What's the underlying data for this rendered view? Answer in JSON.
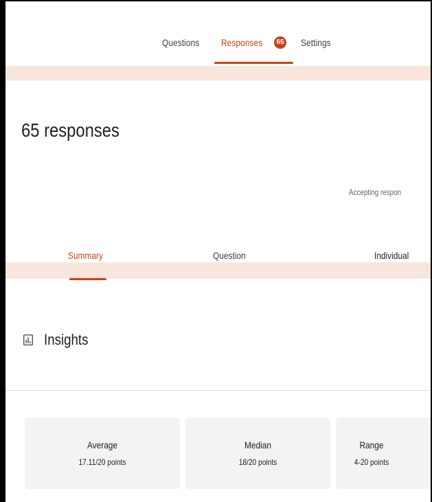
{
  "top_tabs": {
    "questions": "Questions",
    "responses": "Responses",
    "responses_badge": "65",
    "settings": "Settings"
  },
  "header": {
    "title": "65 responses",
    "accepting": "Accepting respon"
  },
  "sub_tabs": {
    "summary": "Summary",
    "question": "Question",
    "individual": "Individual"
  },
  "insights": {
    "title": "Insights",
    "icon": "bar-chart-icon"
  },
  "stats": [
    {
      "label": "Average",
      "value": "17.11/20 points"
    },
    {
      "label": "Median",
      "value": "18/20 points"
    },
    {
      "label": "Range",
      "value": "4-20 points"
    }
  ],
  "colors": {
    "accent": "#c5431a",
    "band": "#f8e6dd",
    "card": "#f1f3f4"
  }
}
